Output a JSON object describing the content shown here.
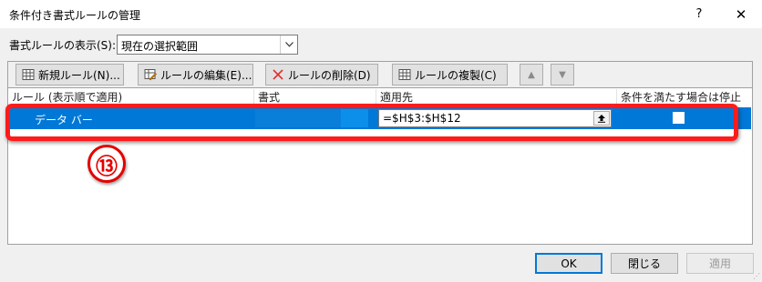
{
  "window": {
    "title": "条件付き書式ルールの管理",
    "help_label": "?",
    "close_label": "✕"
  },
  "show_rules": {
    "label": "書式ルールの表示(S):",
    "selected": "現在の選択範囲"
  },
  "toolbar": {
    "new_label": "新規ルール(N)...",
    "edit_label": "ルールの編集(E)...",
    "delete_label": "ルールの削除(D)",
    "duplicate_label": "ルールの複製(C)",
    "move_up_label": "▲",
    "move_down_label": "▼"
  },
  "table": {
    "headers": [
      "ルール (表示順で適用)",
      "書式",
      "適用先",
      "条件を満たす場合は停止"
    ],
    "rows": [
      {
        "rule": "データ バー",
        "applies_to": "=$H$3:$H$12",
        "stop_if_true": false
      }
    ],
    "selected_row_color": "#0078d7",
    "data_bar_color": "#0a7fd9"
  },
  "annotation": {
    "marker_label": "⑬",
    "highlight_color": "#ff1b1b"
  },
  "dialog_buttons": {
    "ok_label": "OK",
    "close_label": "閉じる",
    "apply_label": "適用"
  }
}
